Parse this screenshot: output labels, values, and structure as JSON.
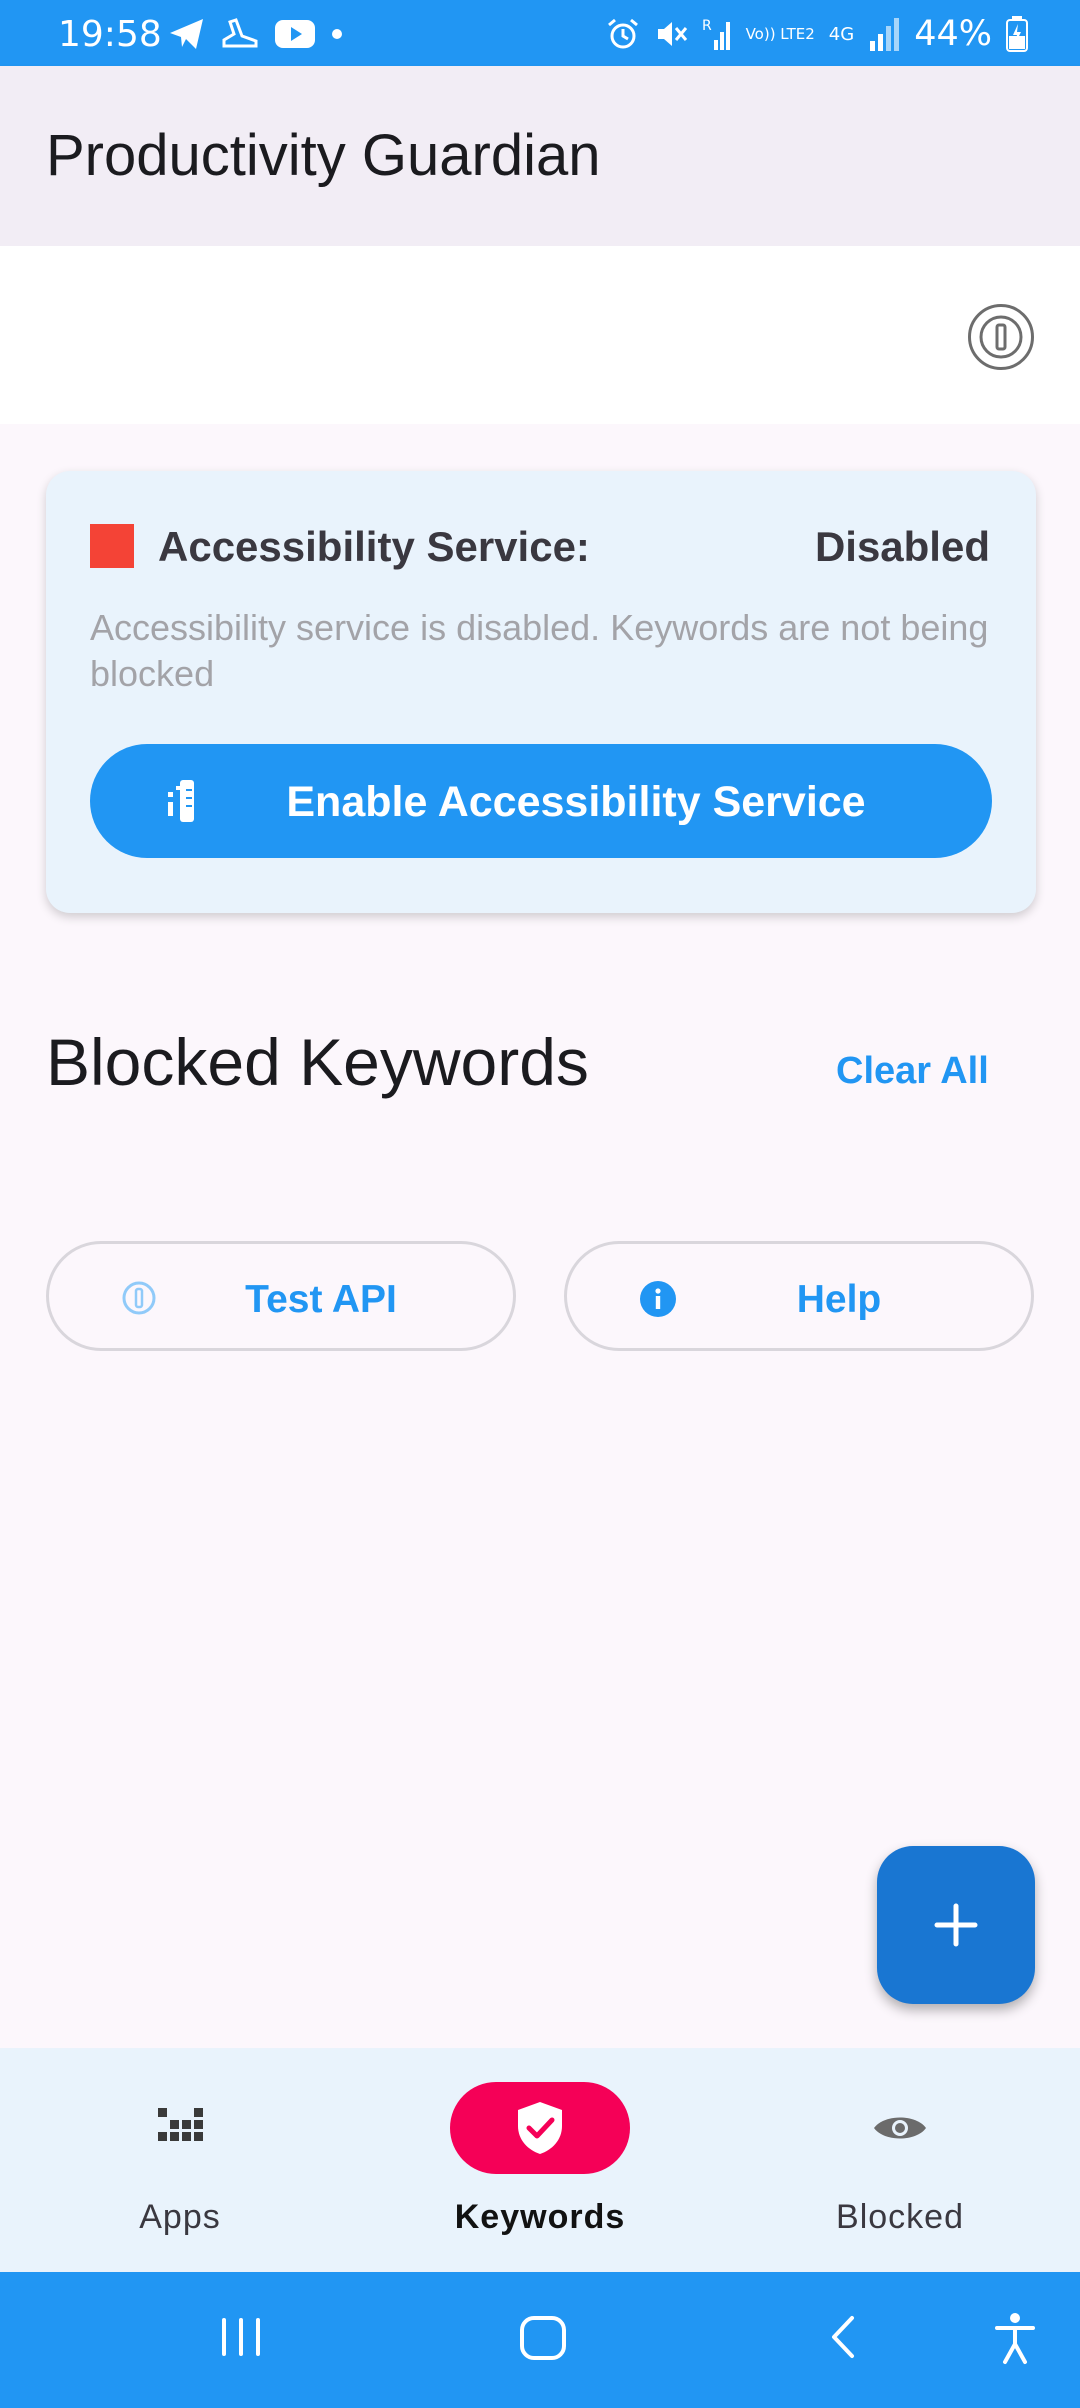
{
  "status_bar": {
    "time": "19:58",
    "battery": "44%",
    "left_icons": [
      "telegram-icon",
      "shoe-icon",
      "youtube-icon",
      "dot-icon"
    ],
    "right_icons": [
      "alarm-icon",
      "mute-icon",
      "signal-r-icon",
      "volte-icon",
      "4g-icon",
      "signal-icon",
      "battery-charging-icon"
    ],
    "volte_text": "Vo)) LTE2",
    "net_text": "4G"
  },
  "app_bar": {
    "title": "Productivity Guardian"
  },
  "accessibility_card": {
    "label": "Accessibility Service:",
    "status": "Disabled",
    "status_color": "#f44336",
    "description": "Accessibility service is disabled. Keywords are not being blocked",
    "button_label": "Enable Accessibility Service"
  },
  "keywords_section": {
    "title": "Blocked Keywords",
    "clear_all": "Clear All"
  },
  "actions": {
    "test_api": "Test API",
    "help": "Help"
  },
  "fab": {
    "icon": "plus-icon"
  },
  "bottom_nav": {
    "items": [
      {
        "label": "Apps",
        "icon": "apps-grid-icon",
        "selected": false
      },
      {
        "label": "Keywords",
        "icon": "shield-check-icon",
        "selected": true
      },
      {
        "label": "Blocked",
        "icon": "eye-icon",
        "selected": false
      }
    ]
  },
  "colors": {
    "primary": "#2196f3",
    "fab": "#1976d2",
    "selected_nav": "#f50057",
    "disabled_indicator": "#f44336"
  }
}
